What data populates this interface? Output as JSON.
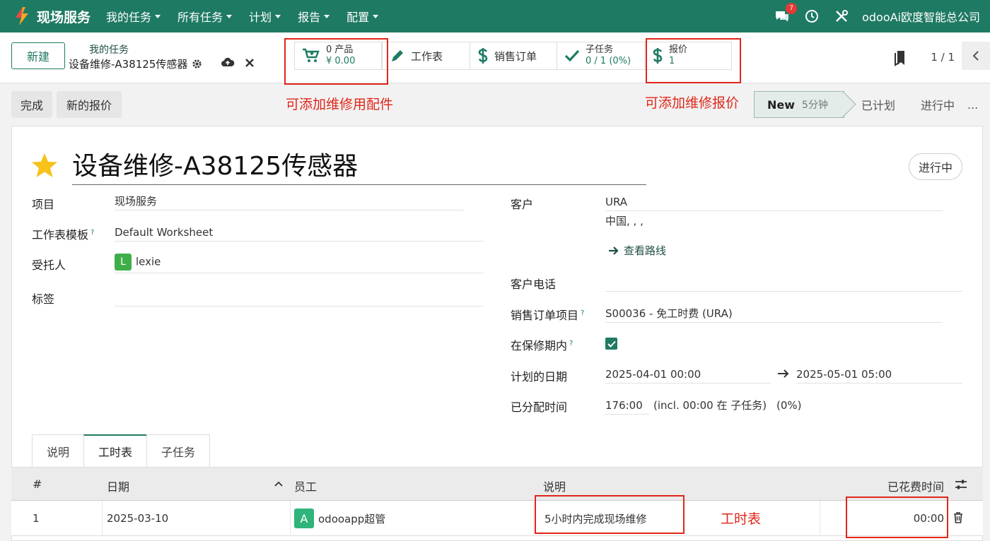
{
  "nav": {
    "app_name": "现场服务",
    "menu": [
      "我的任务",
      "所有任务",
      "计划",
      "报告",
      "配置"
    ],
    "chat_badge": "7",
    "company": "odooAi欧度智能总公司"
  },
  "control": {
    "new_button": "新建",
    "breadcrumb_parent": "我的任务",
    "breadcrumb_current": "设备维修-A38125传感器",
    "smart_buttons": {
      "products_count": "0 产品",
      "products_amount": "¥ 0.00",
      "worksheet": "工作表",
      "sales_order": "销售订单",
      "subtasks_label": "子任务",
      "subtasks_value": "0 / 1 (0%)",
      "quotation_label": "报价",
      "quotation_value": "1"
    },
    "pager": "1 / 1"
  },
  "status": {
    "done_button": "完成",
    "new_quote_button": "新的报价",
    "stages": [
      {
        "label": "New",
        "sub": "5分钟"
      },
      {
        "label": "已计划"
      },
      {
        "label": "进行中"
      },
      {
        "label": "..."
      }
    ]
  },
  "annotations": {
    "parts": "可添加维修用配件",
    "quote": "可添加维修报价",
    "timesheet": "工时表"
  },
  "form": {
    "title": "设备维修-A38125传感器",
    "state_pill": "进行中",
    "project_label": "项目",
    "project_value": "现场服务",
    "template_label": "工作表模板",
    "template_value": "Default Worksheet",
    "assignee_label": "受托人",
    "assignee_initial": "L",
    "assignee_name": "lexie",
    "tags_label": "标签",
    "customer_label": "客户",
    "customer_value": "URA",
    "customer_address": "中国, , ,",
    "route_link": "查看路线",
    "phone_label": "客户电话",
    "so_item_label": "销售订单项目",
    "so_item_value": "S00036 - 免工时费 (URA)",
    "warranty_label": "在保修期内",
    "planned_label": "计划的日期",
    "planned_start": "2025-04-01 00:00",
    "planned_end": "2025-05-01 05:00",
    "allocated_label": "已分配时间",
    "allocated_value": "176:00",
    "allocated_note": "(incl. 00:00 在 子任务)",
    "allocated_pct": "(0%)"
  },
  "tabs": [
    "说明",
    "工时表",
    "子任务"
  ],
  "timesheet": {
    "columns": [
      "#",
      "日期",
      "员工",
      "说明",
      "已花费时间"
    ],
    "rows": [
      {
        "num": "1",
        "date": "2025-03-10",
        "employee_initial": "A",
        "employee": "odooapp超管",
        "description": "5小时内完成现场维修",
        "spent": "00:00"
      }
    ]
  },
  "colors": {
    "brand": "#1f7a63",
    "annotation": "#e0261a"
  }
}
